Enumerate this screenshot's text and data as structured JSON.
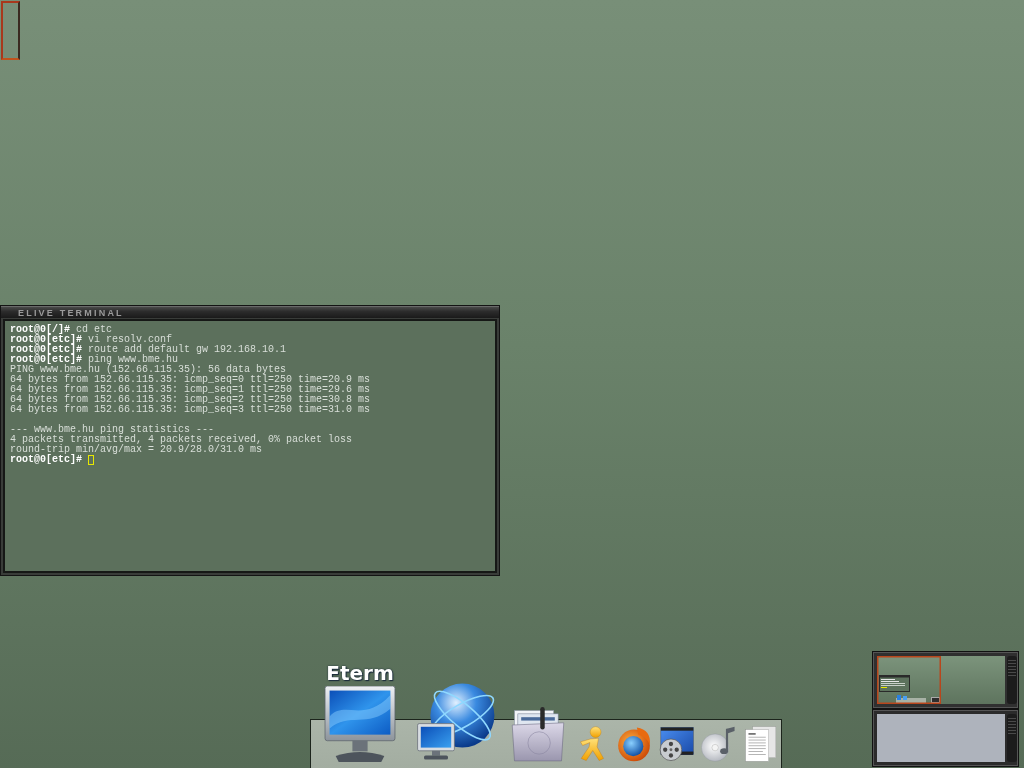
{
  "terminal": {
    "title": "ELIVE TERMINAL",
    "output_blocks": [
      [
        "**root@0[/]#** cd etc",
        "**root@0[etc]#** vi resolv.conf",
        "**root@0[etc]#** route add default gw 192.168.10.1",
        "**root@0[etc]#** ping www.bme.hu",
        "PING www.bme.hu (152.66.115.35): 56 data bytes",
        "64 bytes from 152.66.115.35: icmp_seq=0 ttl=250 time=20.9 ms",
        "64 bytes from 152.66.115.35: icmp_seq=1 ttl=250 time=29.6 ms",
        "64 bytes from 152.66.115.35: icmp_seq=2 ttl=250 time=30.8 ms",
        "64 bytes from 152.66.115.35: icmp_seq=3 ttl=250 time=31.0 ms"
      ],
      [
        "--- www.bme.hu ping statistics ---",
        "4 packets transmitted, 4 packets received, 0% packet loss",
        "round-trip min/avg/max = 20.9/28.0/31.0 ms",
        "**root@0[etc]#**"
      ]
    ],
    "cursor": true
  },
  "dock": {
    "items": [
      {
        "kind": "terminal",
        "label": "Eterm",
        "hovered": true
      },
      {
        "kind": "network",
        "hovered": false
      },
      {
        "kind": "files",
        "hovered": false
      },
      {
        "kind": "messenger",
        "hovered": false
      },
      {
        "kind": "browser",
        "hovered": false
      },
      {
        "kind": "video",
        "hovered": false
      },
      {
        "kind": "music",
        "hovered": false
      },
      {
        "kind": "documents",
        "hovered": false
      }
    ]
  },
  "pager": {
    "desks": [
      {
        "selected": true
      },
      {
        "selected": false
      }
    ]
  }
}
